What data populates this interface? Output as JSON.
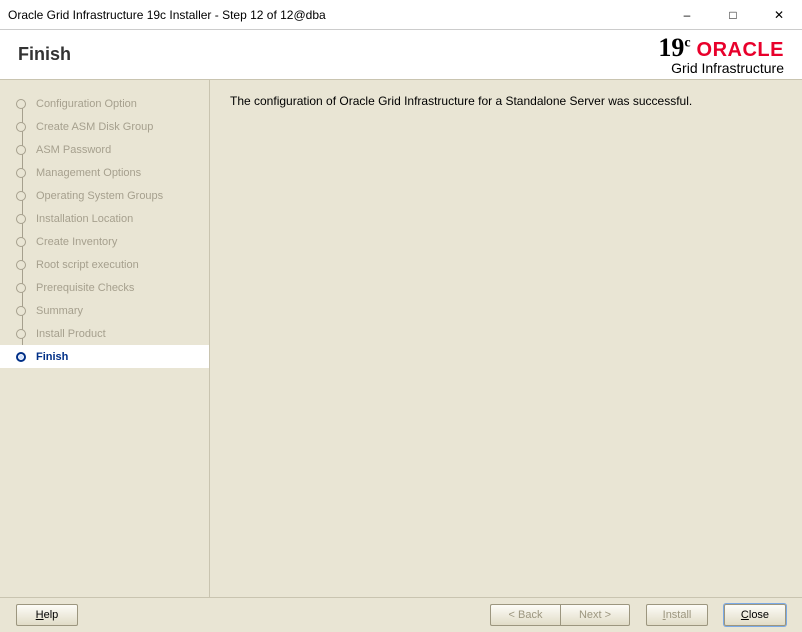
{
  "window": {
    "title": "Oracle Grid Infrastructure 19c Installer - Step 12 of 12@dba"
  },
  "header": {
    "page_title": "Finish",
    "brand_version": "19",
    "brand_version_suffix": "c",
    "brand_name": "ORACLE",
    "brand_product": "Grid Infrastructure"
  },
  "sidebar": {
    "steps": [
      {
        "label": "Configuration Option"
      },
      {
        "label": "Create ASM Disk Group"
      },
      {
        "label": "ASM Password"
      },
      {
        "label": "Management Options"
      },
      {
        "label": "Operating System Groups"
      },
      {
        "label": "Installation Location"
      },
      {
        "label": "Create Inventory"
      },
      {
        "label": "Root script execution"
      },
      {
        "label": "Prerequisite Checks"
      },
      {
        "label": "Summary"
      },
      {
        "label": "Install Product"
      },
      {
        "label": "Finish"
      }
    ]
  },
  "main": {
    "message": "The configuration of Oracle Grid Infrastructure for a Standalone Server was successful."
  },
  "footer": {
    "help_u": "H",
    "help_rest": "elp",
    "back": "< Back",
    "next": "Next >",
    "install_u": "I",
    "install_rest": "nstall",
    "close_u": "C",
    "close_rest": "lose"
  }
}
